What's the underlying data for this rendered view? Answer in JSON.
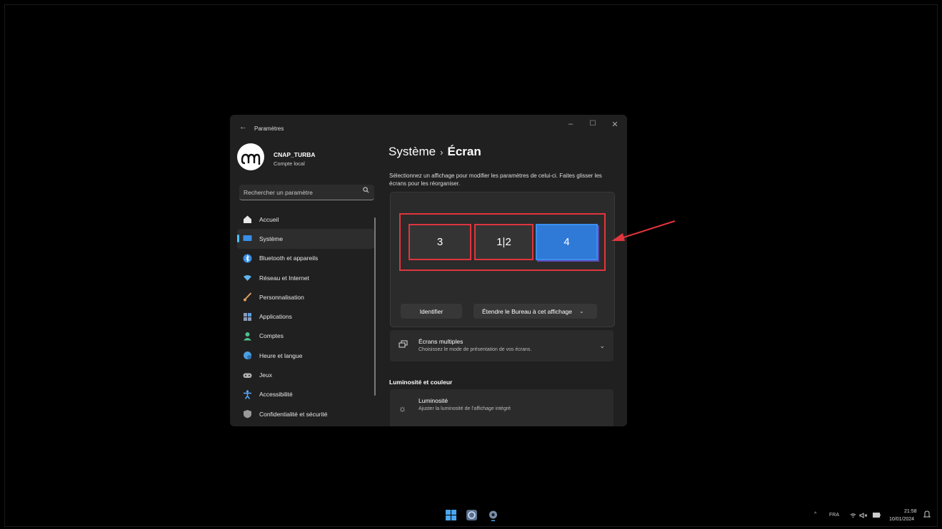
{
  "window": {
    "title": "Paramètres",
    "controls": {
      "minimize": "–",
      "maximize": "☐",
      "close": "✕"
    }
  },
  "profile": {
    "name": "CNAP_TURBA",
    "account_type": "Compte local"
  },
  "search": {
    "placeholder": "Rechercher un paramètre"
  },
  "sidebar": {
    "items": [
      {
        "label": "Accueil",
        "icon": "home-icon",
        "color": "#e8e8e8"
      },
      {
        "label": "Système",
        "icon": "display-icon",
        "color": "#3a8ee6",
        "active": true
      },
      {
        "label": "Bluetooth et appareils",
        "icon": "bluetooth-icon",
        "color": "#3a8ee6"
      },
      {
        "label": "Réseau et Internet",
        "icon": "wifi-icon",
        "color": "#5fb4f0"
      },
      {
        "label": "Personnalisation",
        "icon": "brush-icon",
        "color": "#e0a060"
      },
      {
        "label": "Applications",
        "icon": "apps-icon",
        "color": "#8a9ab8"
      },
      {
        "label": "Comptes",
        "icon": "person-icon",
        "color": "#4fc08a"
      },
      {
        "label": "Heure et langue",
        "icon": "globe-clock-icon",
        "color": "#4aa0e0"
      },
      {
        "label": "Jeux",
        "icon": "gamepad-icon",
        "color": "#b0b0b0"
      },
      {
        "label": "Accessibilité",
        "icon": "accessibility-icon",
        "color": "#5aa8ff"
      },
      {
        "label": "Confidentialité et sécurité",
        "icon": "shield-icon",
        "color": "#9a9a9a"
      }
    ]
  },
  "main": {
    "breadcrumb_parent": "Système",
    "breadcrumb_sep": "›",
    "breadcrumb_current": "Écran",
    "description": "Sélectionnez un affichage pour modifier les paramètres de celui-ci. Faites glisser les écrans pour les réorganiser.",
    "monitors": [
      "3",
      "1|2",
      "4"
    ],
    "selected_monitor": "4",
    "identify_label": "Identifier",
    "extend_label": "Étendre le Bureau à cet affichage",
    "multi_title": "Écrans multiples",
    "multi_sub": "Choisissez le mode de présentation de vos écrans.",
    "section_brightness": "Luminosité et couleur",
    "brightness_title": "Luminosité",
    "brightness_sub": "Ajuster la luminosité de l’affichage intégré"
  },
  "taskbar": {
    "apps": [
      "windows-start-icon",
      "browser-icon",
      "settings-gear-icon"
    ],
    "tray": {
      "chevron": "^",
      "lang": "FRA"
    },
    "time": "21:58",
    "date": "10/01/2024"
  },
  "colors": {
    "accent": "#2f7ad6",
    "annotation": "#e0353d"
  }
}
